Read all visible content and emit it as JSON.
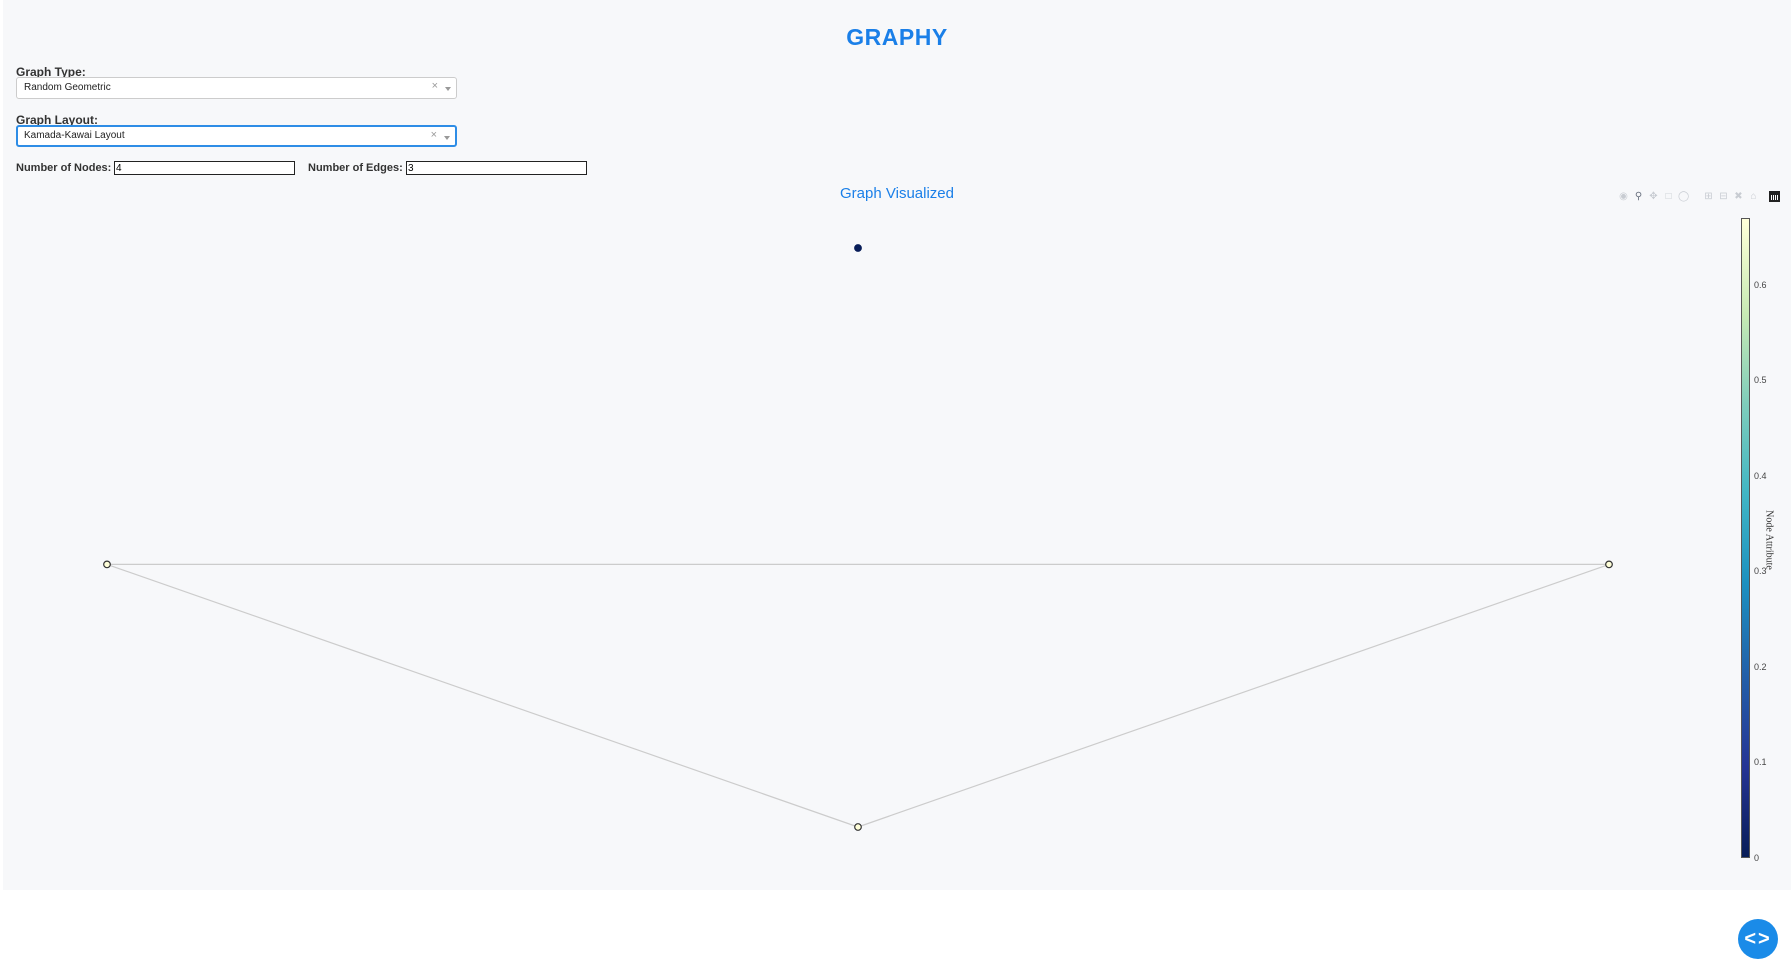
{
  "app": {
    "title": "GRAPHY"
  },
  "controls": {
    "graph_type": {
      "label": "Graph Type:",
      "value": "Random Geometric",
      "clear_symbol": "×"
    },
    "graph_layout": {
      "label": "Graph Layout:",
      "value": "Kamada-Kawai Layout",
      "clear_symbol": "×"
    },
    "nodes": {
      "label": "Number of Nodes:",
      "value": "4"
    },
    "edges": {
      "label": "Number of Edges:",
      "value": "3"
    }
  },
  "plot": {
    "title": "Graph Visualized",
    "colorbar": {
      "title": "Node Attribute",
      "ticks": [
        "0",
        "0.1",
        "0.2",
        "0.3",
        "0.4",
        "0.5",
        "0.6"
      ],
      "range": [
        0,
        0.67
      ],
      "colorscale": "YlGnBu"
    },
    "modebar": [
      "camera-icon",
      "zoom-icon",
      "pan-icon",
      "box-select-icon",
      "lasso-icon",
      "zoom-in-icon",
      "zoom-out-icon",
      "autoscale-icon",
      "reset-axes-icon",
      "plotly-logo-icon"
    ]
  },
  "chart_data": {
    "type": "network",
    "title": "Graph Visualized",
    "nodes": [
      {
        "id": 0,
        "x": 0.0,
        "y": 1.0,
        "attribute": 0.0,
        "color": "#081d58"
      },
      {
        "id": 1,
        "x": -1.0,
        "y": 0.0,
        "attribute": 0.67,
        "color": "#ffffd9"
      },
      {
        "id": 2,
        "x": 1.0,
        "y": 0.0,
        "attribute": 0.67,
        "color": "#ffffd9"
      },
      {
        "id": 3,
        "x": 0.0,
        "y": -0.83,
        "attribute": 0.67,
        "color": "#ffffd9"
      }
    ],
    "edges": [
      [
        1,
        2
      ],
      [
        1,
        3
      ],
      [
        2,
        3
      ]
    ],
    "xlim": [
      -1.0,
      1.0
    ],
    "ylim": [
      -0.83,
      1.0
    ],
    "edge_color": "#cccccc",
    "colorbar_title": "Node Attribute"
  },
  "fab": {
    "icon": "code-icon",
    "glyph": "<>"
  }
}
